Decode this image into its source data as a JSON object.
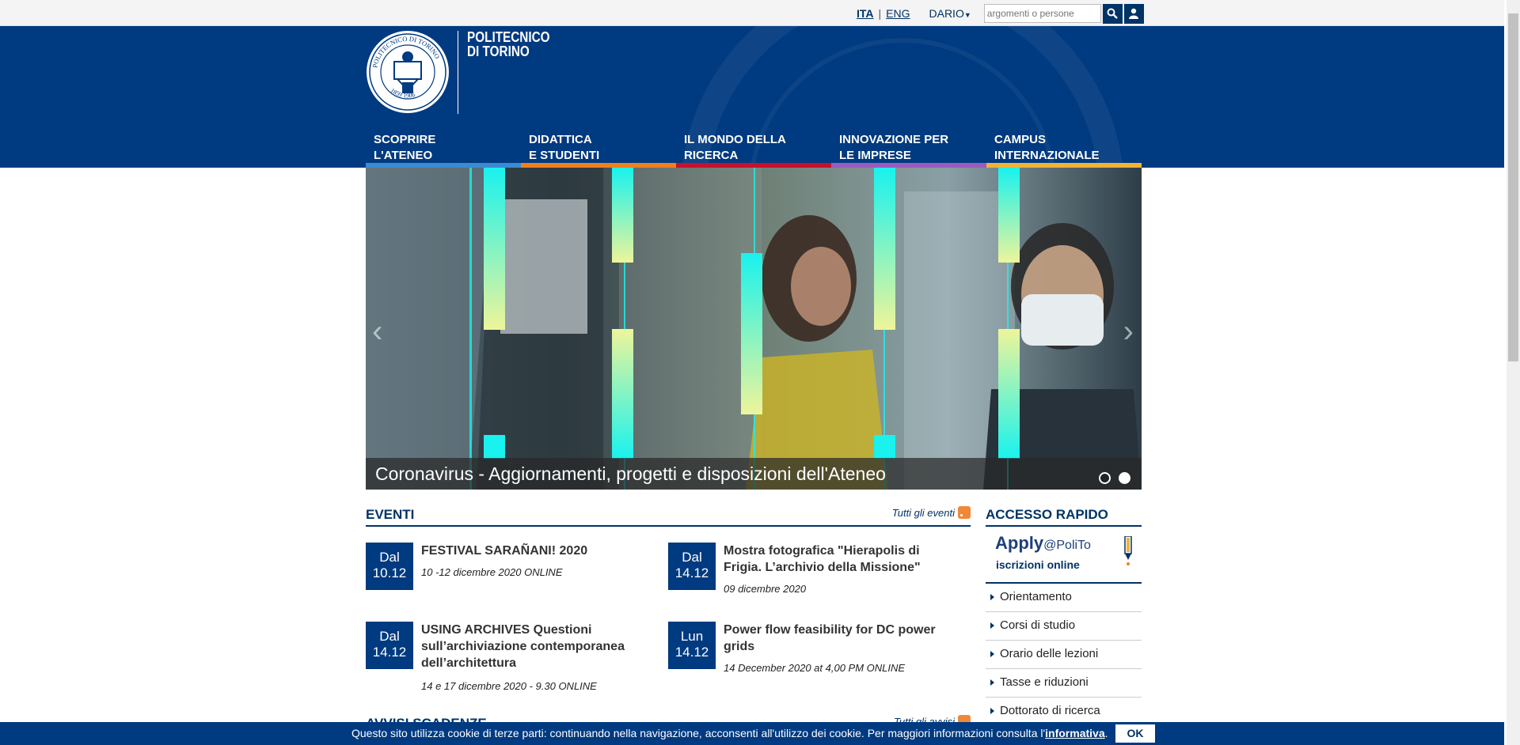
{
  "topbar": {
    "lang_ita": "ITA",
    "lang_eng": "ENG",
    "user": "DARIO",
    "search_placeholder": "argomenti o persone"
  },
  "header": {
    "logo_line1": "POLITECNICO",
    "logo_line2": "DI TORINO",
    "seal_text": "POLITECNICO DI TORINO",
    "seal_years": "1859 1906"
  },
  "nav": [
    {
      "line1": "SCOPRIRE",
      "line2": "L'ATENEO",
      "color": "#3a8bd1"
    },
    {
      "line1": "DIDATTICA",
      "line2": "E STUDENTI",
      "color": "#f07f1e"
    },
    {
      "line1": "IL MONDO DELLA",
      "line2": "RICERCA",
      "color": "#c8102e"
    },
    {
      "line1": "INNOVAZIONE PER",
      "line2": "LE IMPRESE",
      "color": "#9a5bbf"
    },
    {
      "line1": "CAMPUS",
      "line2": "INTERNAZIONALE",
      "color": "#f2b233"
    }
  ],
  "slider": {
    "caption": "Coronavirus - Aggiornamenti, progetti e disposizioni dell'Ateneo",
    "active_slide": 2,
    "slide_count": 2
  },
  "events": {
    "title": "EVENTI",
    "all_link": "Tutti gli eventi",
    "items": [
      {
        "day": "Dal",
        "date": "10.12",
        "title": "FESTIVAL SARAÑANI! 2020",
        "sub": "10 -12 dicembre 2020 ONLINE"
      },
      {
        "day": "Dal",
        "date": "14.12",
        "title": "Mostra fotografica \"Hierapolis di Frigia. L’archivio della Missione\"",
        "sub": "09 dicembre 2020"
      },
      {
        "day": "Dal",
        "date": "14.12",
        "title": "USING ARCHIVES Questioni sull’archiviazione contemporanea dell’architettura",
        "sub": "14 e 17 dicembre 2020 - 9.30 ONLINE"
      },
      {
        "day": "Lun",
        "date": "14.12",
        "title": "Power flow feasibility for DC power grids",
        "sub": "14 December 2020 at 4,00 PM ONLINE"
      }
    ]
  },
  "avvisi": {
    "title": "AVVISI SCADENZE",
    "all_link": "Tutti gli avvisi"
  },
  "quick": {
    "title": "ACCESSO RAPIDO",
    "apply_main": "Apply",
    "apply_at": "@PoliTo",
    "apply_sub": "iscrizioni online",
    "links": [
      "Orientamento",
      "Corsi di studio",
      "Orario delle lezioni",
      "Tasse e riduzioni",
      "Dottorato di ricerca"
    ]
  },
  "cookie": {
    "text": "Questo sito utilizza cookie di terze parti: continuando nella navigazione, acconsenti all'utilizzo dei cookie. Per maggiori informazioni consulta l'",
    "link": "informativa",
    "end": ".",
    "ok": "OK"
  }
}
